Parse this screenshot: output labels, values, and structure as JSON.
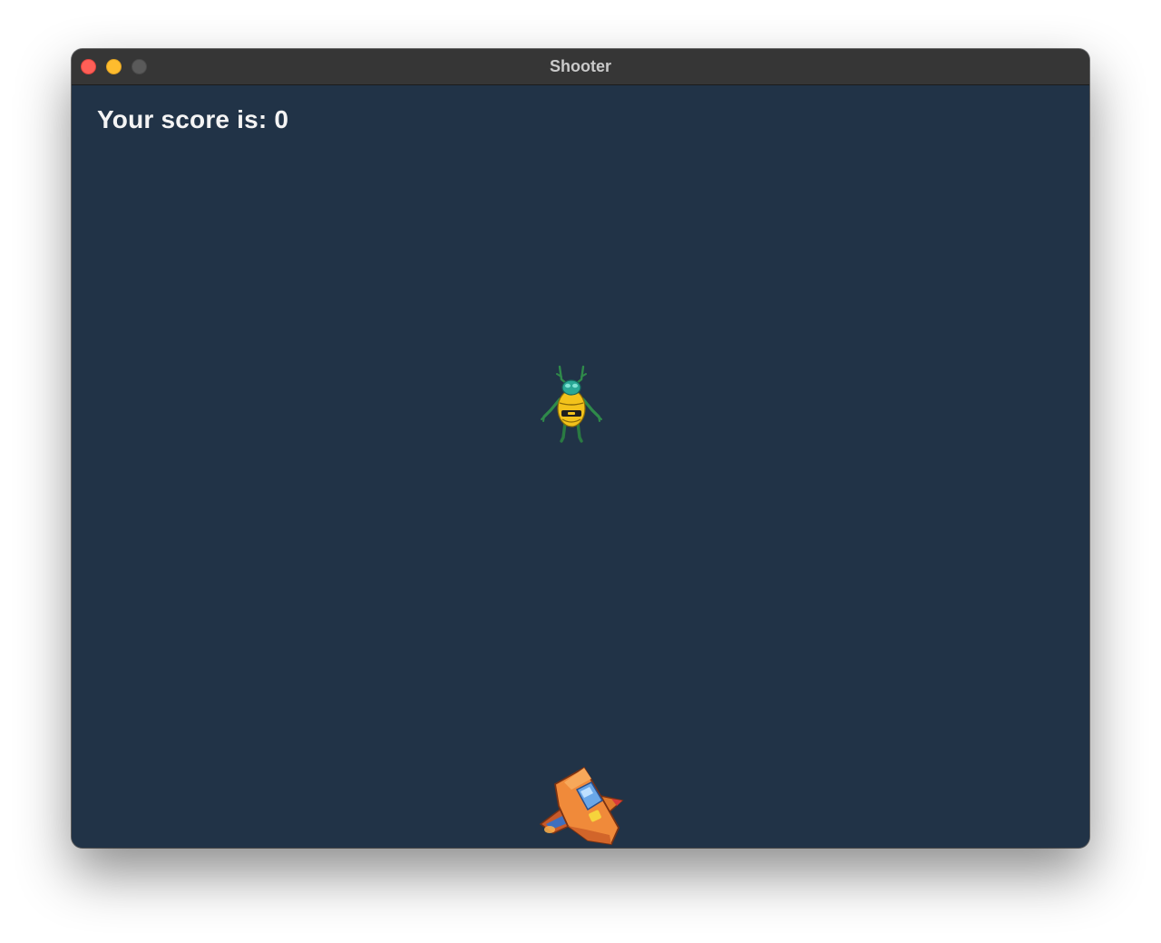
{
  "window": {
    "title": "Shooter"
  },
  "hud": {
    "score_text": "Your score is: 0",
    "score": 0
  },
  "sprites": {
    "enemy": "bug-alien-icon",
    "player": "spaceship-icon"
  },
  "colors": {
    "background": "#213347",
    "titlebar": "#363636",
    "score_text": "#f4f4f4"
  }
}
